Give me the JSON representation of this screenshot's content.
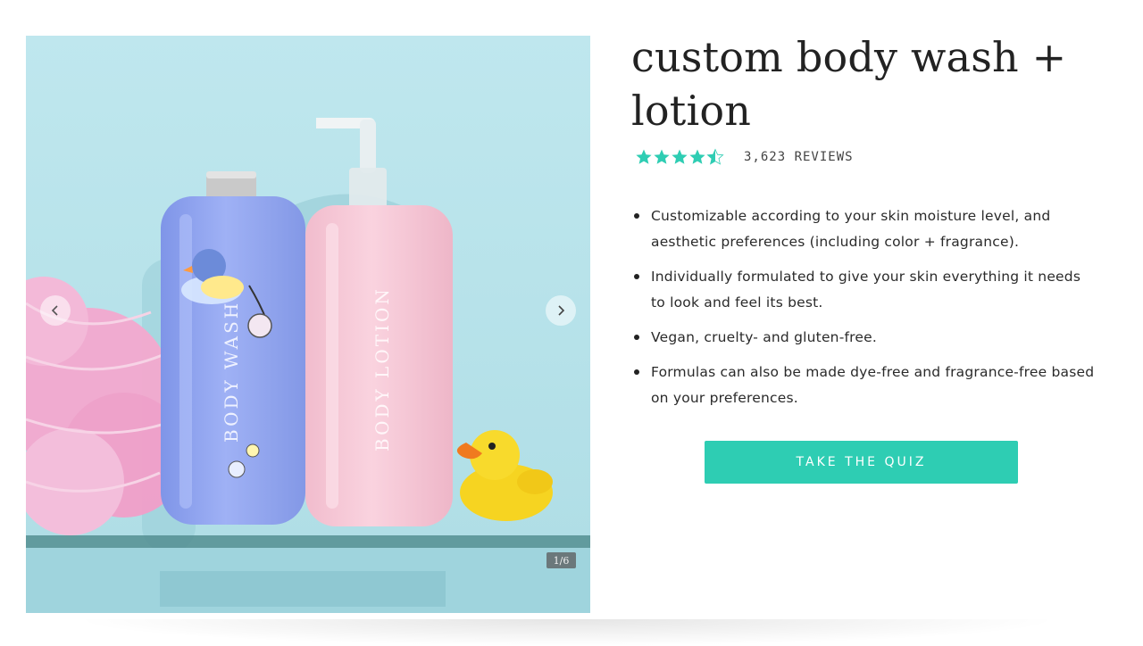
{
  "gallery": {
    "counter": "1/6",
    "bottle_left_label": "BODY WASH",
    "bottle_right_label": "BODY LOTION",
    "icons": {
      "prev": "chevron-left-icon",
      "next": "chevron-right-icon"
    }
  },
  "product": {
    "title": "custom body wash + lotion",
    "rating": {
      "value": 4.5,
      "max": 5,
      "star_color": "#2ecdb3"
    },
    "review_count": "3,623 REVIEWS",
    "bullets": [
      "Customizable according to your skin moisture level, and aesthetic preferences (including color + fragrance).",
      "Individually formulated to give your skin everything it needs to look and feel its best.",
      "Vegan, cruelty- and gluten-free.",
      "Formulas can also be made dye-free and fragrance-free based on your preferences."
    ],
    "cta_label": "TAKE THE QUIZ",
    "cta_color": "#2ecdb3"
  }
}
